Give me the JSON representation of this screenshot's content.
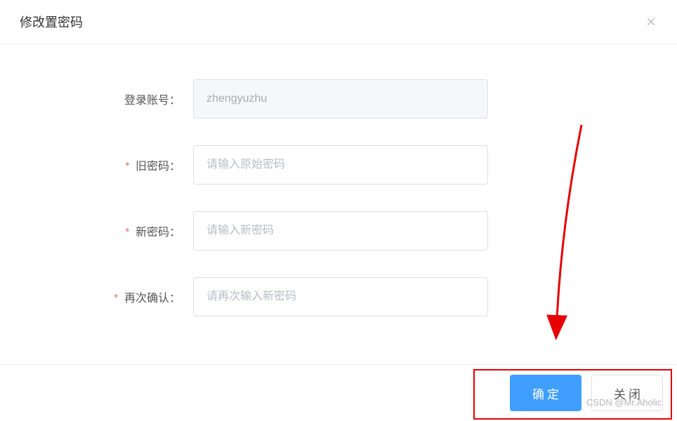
{
  "modal": {
    "title": "修改置密码"
  },
  "form": {
    "account": {
      "label": "登录账号：",
      "value": "zhengyuzhu",
      "required": false
    },
    "oldPassword": {
      "label": "旧密码：",
      "placeholder": "请输入原始密码",
      "required": true
    },
    "newPassword": {
      "label": "新密码：",
      "placeholder": "请输入新密码",
      "required": true
    },
    "confirmPassword": {
      "label": "再次确认：",
      "placeholder": "请再次输入新密码",
      "required": true
    }
  },
  "footer": {
    "confirm": "确定",
    "close": "关闭"
  },
  "watermark": "CSDN @Mr.Aholic",
  "requiredStar": "*"
}
